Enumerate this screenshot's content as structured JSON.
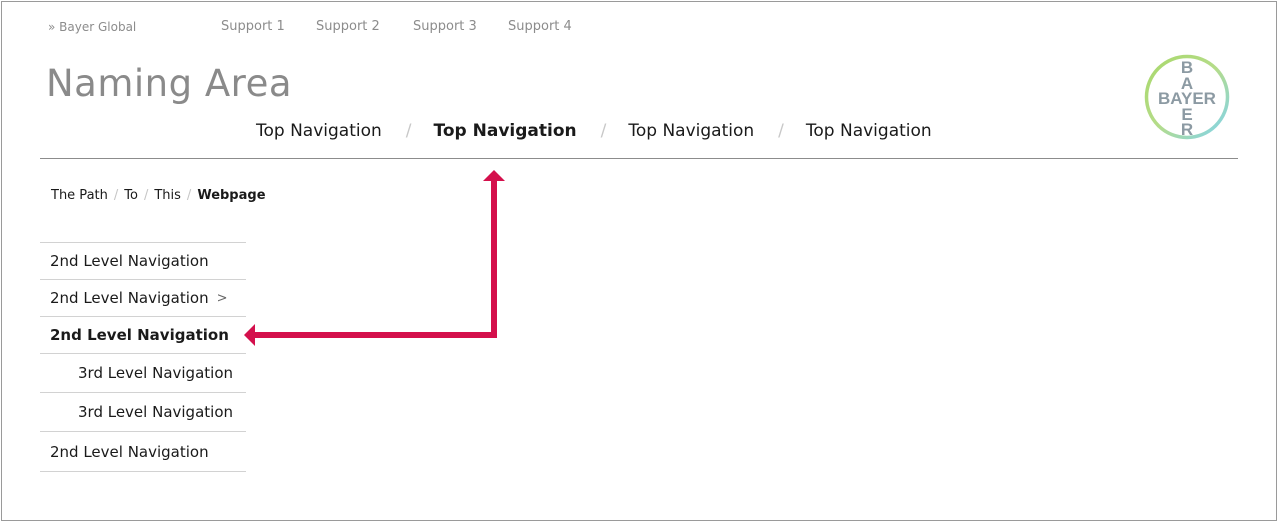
{
  "service_nav": {
    "global_link": "» Bayer Global",
    "support_links": [
      "Support 1",
      "Support 2",
      "Support 3",
      "Support 4"
    ]
  },
  "header": {
    "title": "Naming Area",
    "logo": {
      "name": "bayer-cross-logo",
      "horizontal": "BAYER",
      "vertical": [
        "B",
        "A",
        "Y",
        "E",
        "R"
      ],
      "colors": [
        "#a8d86a",
        "#7fd3f0"
      ]
    }
  },
  "top_nav": {
    "separator": "/",
    "items": [
      {
        "label": "Top Navigation",
        "active": false
      },
      {
        "label": "Top Navigation",
        "active": true
      },
      {
        "label": "Top Navigation",
        "active": false
      },
      {
        "label": "Top Navigation",
        "active": false
      }
    ]
  },
  "breadcrumb": {
    "separator": "/",
    "items": [
      "The Path",
      "To",
      "This"
    ],
    "current": "Webpage"
  },
  "sub_nav": {
    "items": [
      {
        "label": "2nd Level Navigation",
        "level": 2,
        "active": false,
        "has_children": false
      },
      {
        "label": "2nd Level Navigation",
        "level": 2,
        "active": false,
        "has_children": true,
        "chevron": ">"
      },
      {
        "label": "2nd Level Navigation",
        "level": 2,
        "active": true,
        "has_children": false
      },
      {
        "label": "3rd Level Navigation",
        "level": 3,
        "active": false
      },
      {
        "label": "3rd Level Navigation",
        "level": 3,
        "active": false
      },
      {
        "label": "2nd Level Navigation",
        "level": 2,
        "active": false
      }
    ]
  },
  "annotation": {
    "arrow_color": "#d4104c",
    "description": "Connector arrow linking active top navigation item to active 2nd level navigation item"
  }
}
